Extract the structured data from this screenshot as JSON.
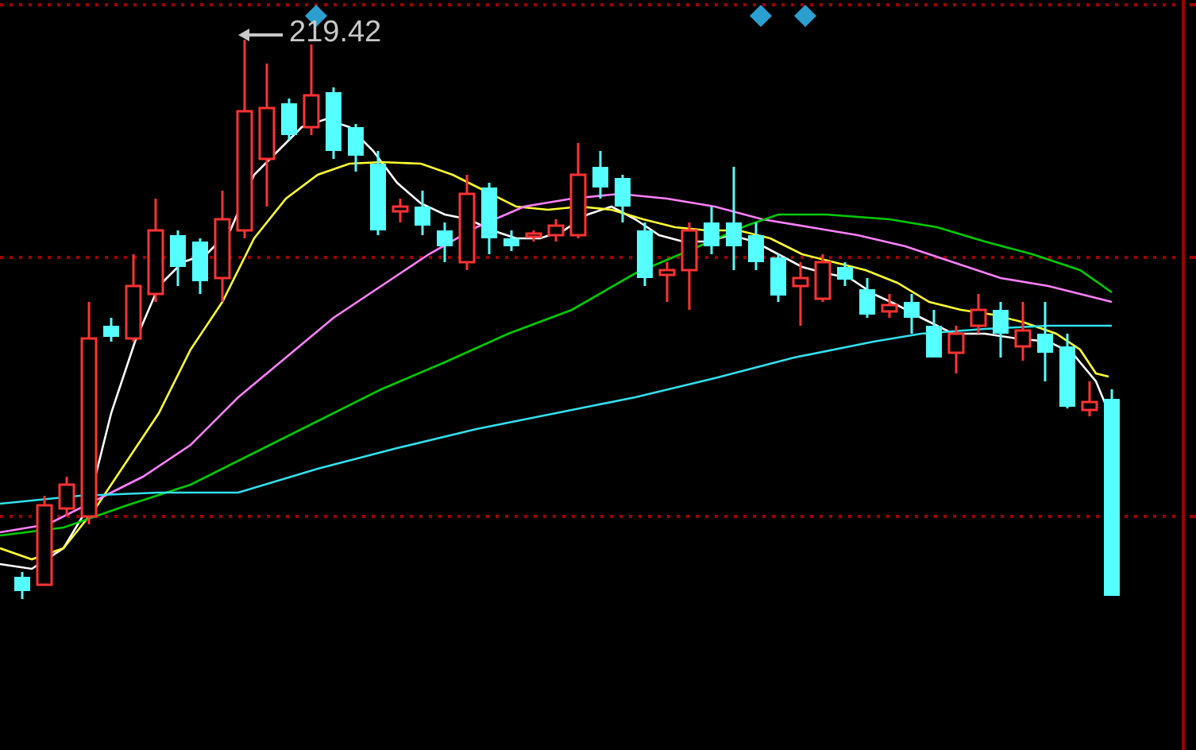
{
  "chart": {
    "high_label": "219.42"
  }
}
